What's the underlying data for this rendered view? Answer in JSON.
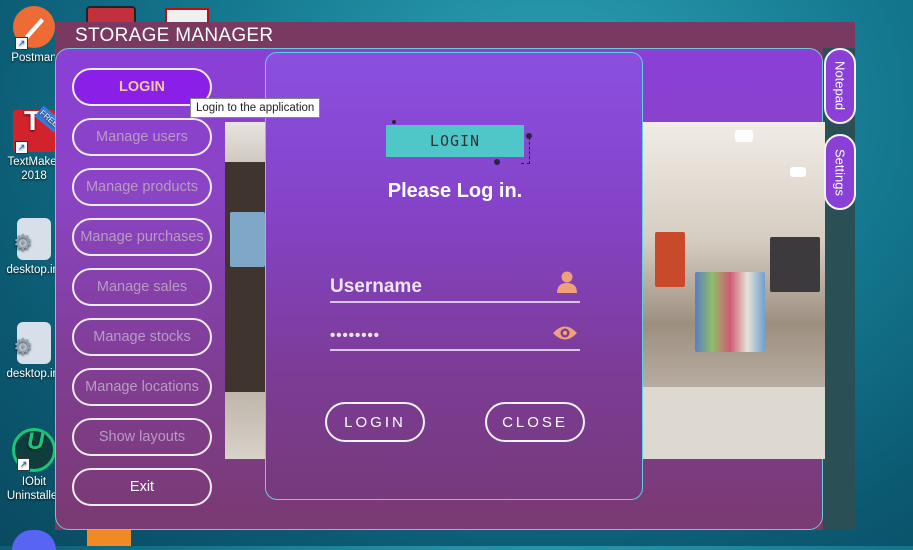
{
  "desktop": {
    "icons": [
      {
        "label": "Postman",
        "icon": "postman-icon"
      },
      {
        "label": "TextMaker 2018",
        "icon": "textmaker-icon",
        "badge": "FREE"
      },
      {
        "label": "desktop.ini",
        "icon": "ini-file-icon"
      },
      {
        "label": "desktop.ini",
        "icon": "ini-file-icon"
      },
      {
        "label": "IObit Uninstaller",
        "icon": "iobit-uninstaller-icon"
      }
    ]
  },
  "window": {
    "title": "STORAGE MANAGER"
  },
  "sidebar": {
    "items": [
      {
        "label": "LOGIN",
        "active": true
      },
      {
        "label": "Manage users"
      },
      {
        "label": "Manage products"
      },
      {
        "label": "Manage purchases"
      },
      {
        "label": "Manage sales"
      },
      {
        "label": "Manage stocks"
      },
      {
        "label": "Manage locations"
      },
      {
        "label": "Show layouts"
      },
      {
        "label": "Exit"
      }
    ]
  },
  "tooltip": "Login to the application",
  "side_tabs": [
    {
      "label": "Notepad"
    },
    {
      "label": "Settings"
    }
  ],
  "login": {
    "logo_text": "LOGIN",
    "heading": "Please Log in.",
    "username_placeholder": "Username",
    "password_value": "••••••••",
    "login_button": "LOGIN",
    "close_button": "CLOSE"
  },
  "colors": {
    "window_bg": "#7a3960",
    "accent_purple": "#8a3fd6",
    "active_button": "#8a1fe8",
    "logo_teal": "#4fc7c9",
    "icon_orange": "#f0a07a"
  }
}
